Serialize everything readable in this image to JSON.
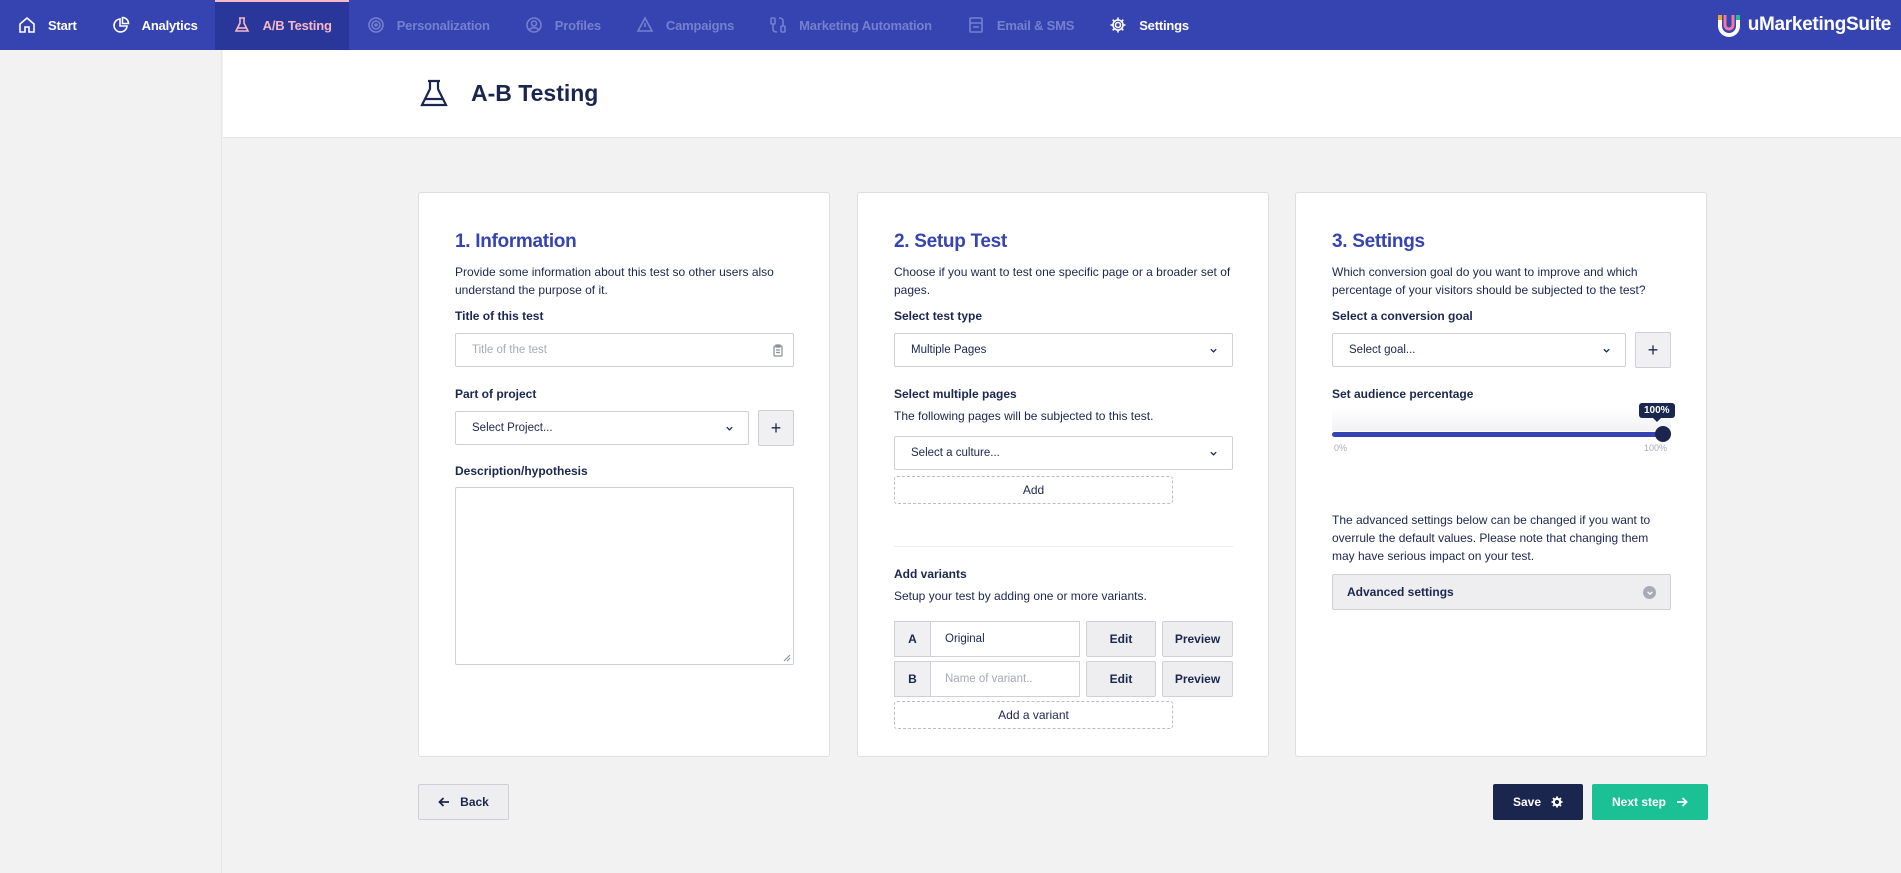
{
  "nav": {
    "items": [
      {
        "label": "Start",
        "icon": "home-icon",
        "state": "normal"
      },
      {
        "label": "Analytics",
        "icon": "pie-chart-icon",
        "state": "normal"
      },
      {
        "label": "A/B Testing",
        "icon": "flask-icon",
        "state": "active"
      },
      {
        "label": "Personalization",
        "icon": "target-icon",
        "state": "disabled"
      },
      {
        "label": "Profiles",
        "icon": "profile-icon",
        "state": "disabled"
      },
      {
        "label": "Campaigns",
        "icon": "campaign-icon",
        "state": "disabled"
      },
      {
        "label": "Marketing Automation",
        "icon": "automation-icon",
        "state": "disabled"
      },
      {
        "label": "Email & SMS",
        "icon": "mail-icon",
        "state": "disabled"
      },
      {
        "label": "Settings",
        "icon": "gear-icon",
        "state": "normal"
      }
    ],
    "brand": "uMarketingSuite"
  },
  "header": {
    "title": "A-B Testing",
    "icon": "flask-icon"
  },
  "info": {
    "heading": "1. Information",
    "description": "Provide some information about this test so other users also understand the purpose of it.",
    "title_label": "Title of this test",
    "title_placeholder": "Title of the test",
    "project_label": "Part of project",
    "project_select": "Select Project...",
    "project_add": "+",
    "description_label": "Description/hypothesis"
  },
  "setup": {
    "heading": "2. Setup Test",
    "description": "Choose if you want to test one specific page or a broader set of pages.",
    "type_label": "Select test type",
    "type_value": "Multiple Pages",
    "pages_label": "Select multiple pages",
    "pages_help": "The following pages will be subjected to this test.",
    "culture_select": "Select a culture...",
    "add_label": "Add",
    "variants_label": "Add variants",
    "variants_help": "Setup your test by adding one or more variants.",
    "variants": [
      {
        "letter": "A",
        "value": "Original",
        "placeholder": ""
      },
      {
        "letter": "B",
        "value": "",
        "placeholder": "Name of variant.."
      }
    ],
    "edit_label": "Edit",
    "preview_label": "Preview",
    "add_variant_label": "Add a variant"
  },
  "settings": {
    "heading": "3. Settings",
    "description": "Which conversion goal do you want to improve and which percentage of your visitors should be subjected to the test?",
    "goal_label": "Select a conversion goal",
    "goal_select": "Select goal...",
    "goal_add": "+",
    "audience_label": "Set audience percentage",
    "audience_value": "100%",
    "audience_fraction": 1.0,
    "slider_min": "0%",
    "slider_max": "100%",
    "advanced_help": "The advanced settings below can be changed if you want to overrule the default values. Please note that changing them may have serious impact on your test.",
    "advanced_label": "Advanced settings"
  },
  "footer": {
    "back": "Back",
    "save": "Save",
    "next": "Next step"
  },
  "colors": {
    "nav_bg": "#3544b1",
    "accent": "#3544b1",
    "dark": "#1b264f",
    "next": "#1bc194",
    "active_text": "#f5b8c7"
  }
}
